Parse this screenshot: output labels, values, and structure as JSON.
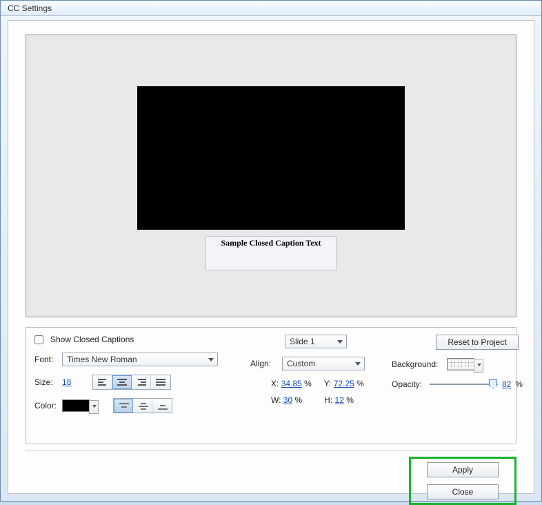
{
  "window": {
    "title": "CC Settings"
  },
  "preview": {
    "caption_text": "Sample Closed Caption Text"
  },
  "controls": {
    "show_cc_label": "Show Closed Captions",
    "font_label": "Font:",
    "font_value": "Times New Roman",
    "size_label": "Size:",
    "size_value": "18",
    "color_label": "Color:",
    "slide_value": "Slide 1",
    "align_label": "Align:",
    "align_value": "Custom",
    "x_label": "X:",
    "x_value": "34.85",
    "x_unit": "%",
    "y_label": "Y:",
    "y_value": "72.25",
    "y_unit": "%",
    "w_label": "W:",
    "w_value": "30",
    "w_unit": "%",
    "h_label": "H:",
    "h_value": "12",
    "h_unit": "%",
    "reset_label": "Reset to Project",
    "background_label": "Background:",
    "opacity_label": "Opacity:",
    "opacity_value": "82",
    "opacity_unit": "%"
  },
  "actions": {
    "apply": "Apply",
    "close": "Close"
  }
}
